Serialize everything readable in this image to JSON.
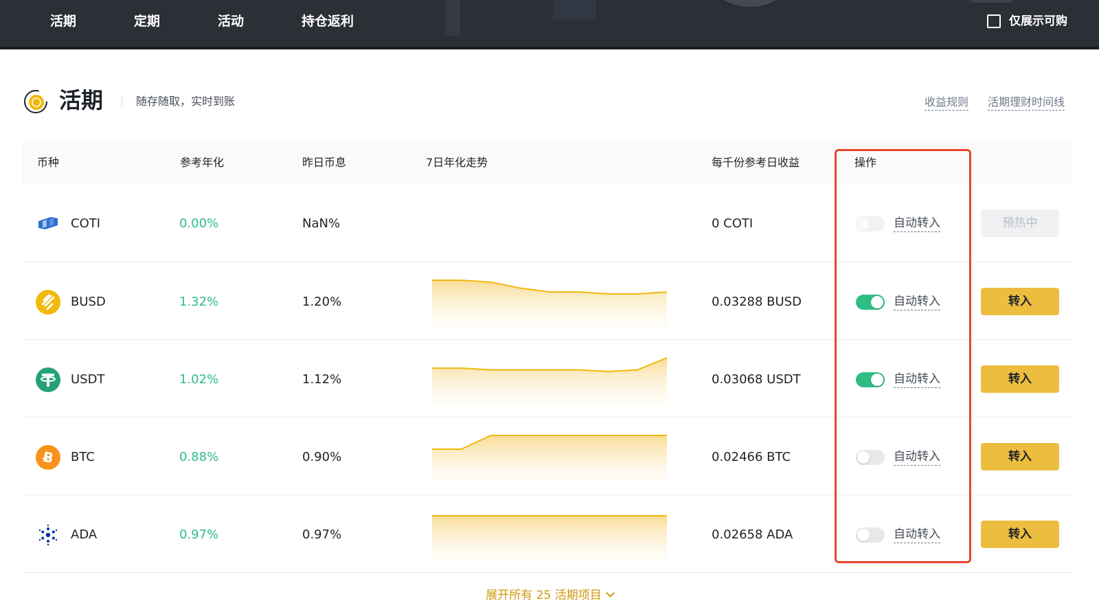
{
  "nav": {
    "tabs": [
      "活期",
      "定期",
      "活动",
      "持仓返利"
    ],
    "show_purchasable_label": "仅展示可购"
  },
  "section": {
    "title": "活期",
    "subtitle": "随存随取，实时到账",
    "links": [
      "收益规则",
      "活期理财时间线"
    ]
  },
  "table": {
    "headers": {
      "coin": "币种",
      "apy": "参考年化",
      "yesterday": "昨日币息",
      "trend": "7日年化走势",
      "per_thousand": "每千份参考日收益",
      "action": "操作"
    },
    "rows": [
      {
        "coin": "COTI",
        "apy": "0.00%",
        "yesterday": "NaN%",
        "per_thousand": "0 COTI",
        "auto_label": "自动转入",
        "auto_on": false,
        "toggle_disabled": true,
        "button": "预热中",
        "button_disabled": true,
        "trend": []
      },
      {
        "coin": "BUSD",
        "apy": "1.32%",
        "yesterday": "1.20%",
        "per_thousand": "0.03288 BUSD",
        "auto_label": "自动转入",
        "auto_on": true,
        "toggle_disabled": false,
        "button": "转入",
        "button_disabled": false,
        "trend": [
          1.32,
          1.32,
          1.31,
          1.28,
          1.26,
          1.26,
          1.25,
          1.25,
          1.26
        ]
      },
      {
        "coin": "USDT",
        "apy": "1.02%",
        "yesterday": "1.12%",
        "per_thousand": "0.03068 USDT",
        "auto_label": "自动转入",
        "auto_on": true,
        "toggle_disabled": false,
        "button": "转入",
        "button_disabled": false,
        "trend": [
          1.02,
          1.02,
          1.01,
          1.01,
          1.01,
          1.01,
          1.0,
          1.01,
          1.08
        ]
      },
      {
        "coin": "BTC",
        "apy": "0.88%",
        "yesterday": "0.90%",
        "per_thousand": "0.02466 BTC",
        "auto_label": "自动转入",
        "auto_on": false,
        "toggle_disabled": false,
        "button": "转入",
        "button_disabled": false,
        "trend": [
          0.88,
          0.88,
          0.9,
          0.9,
          0.9,
          0.9,
          0.9,
          0.9,
          0.9
        ]
      },
      {
        "coin": "ADA",
        "apy": "0.97%",
        "yesterday": "0.97%",
        "per_thousand": "0.02658 ADA",
        "auto_label": "自动转入",
        "auto_on": false,
        "toggle_disabled": false,
        "button": "转入",
        "button_disabled": false,
        "trend": [
          0.97,
          0.97,
          0.97,
          0.97,
          0.97,
          0.97,
          0.97,
          0.97,
          0.97
        ]
      }
    ]
  },
  "expand_label": "展开所有 25 活期项目",
  "colors": {
    "accent": "#ecbd3f",
    "positive": "#2ebd85",
    "highlight_box": "#e8452c",
    "spark_line": "#f0b90b"
  },
  "icons": [
    "coti-icon",
    "busd-icon",
    "usdt-icon",
    "btc-icon",
    "ada-icon",
    "flexible-savings-icon",
    "chevron-down-icon"
  ]
}
